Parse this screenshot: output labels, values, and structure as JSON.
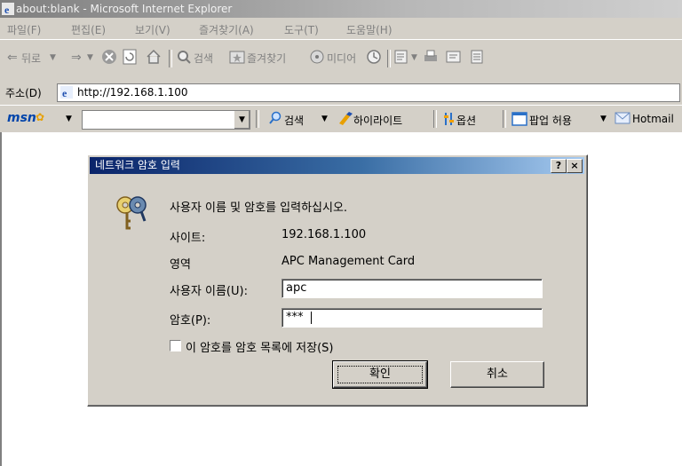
{
  "window": {
    "title": "about:blank - Microsoft Internet Explorer"
  },
  "menu": [
    "파일(F)",
    "편집(E)",
    "보기(V)",
    "즐겨찾기(A)",
    "도구(T)",
    "도움말(H)"
  ],
  "toolbar": {
    "back": "뒤로",
    "search": "검색",
    "favorites": "즐겨찾기",
    "media": "미디어"
  },
  "address": {
    "label": "주소(D)",
    "url": "http://192.168.1.100"
  },
  "msnbar": {
    "logo": "msn",
    "search": "검색",
    "highlight": "하이라이트",
    "options": "옵션",
    "popups": "팝업 허용",
    "hotmail": "Hotmail"
  },
  "dialog": {
    "title": "네트워크 암호 입력",
    "help_btn": "?",
    "close_btn": "×",
    "prompt": "사용자 이름 및 암호를 입력하십시오.",
    "site_label": "사이트:",
    "site_value": "192.168.1.100",
    "realm_label": "영역",
    "realm_value": "APC Management Card",
    "user_label": "사용자 이름(U):",
    "user_value": "apc",
    "password_label": "암호(P):",
    "password_value": "***",
    "save_label": "이 암호를 암호 목록에 저장(S)",
    "ok": "확인",
    "cancel": "취소"
  },
  "icons": [
    "ie-icon",
    "back-icon",
    "forward-icon",
    "stop-icon",
    "refresh-icon",
    "home-icon",
    "search-icon",
    "favorites-icon",
    "media-icon",
    "history-icon",
    "mail-icon",
    "print-icon",
    "edit-icon",
    "discuss-icon",
    "page-icon",
    "keys-icon",
    "highlight-icon",
    "options-icon",
    "popup-icon",
    "hotmail-icon"
  ]
}
